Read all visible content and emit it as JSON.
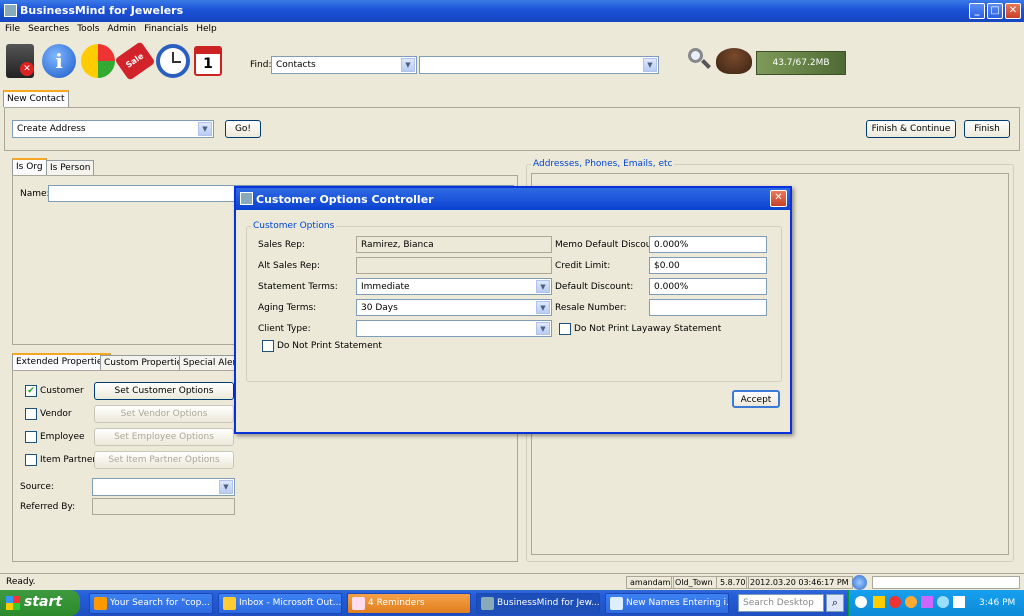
{
  "window": {
    "title": "BusinessMind for Jewelers"
  },
  "menu": [
    "File",
    "Searches",
    "Tools",
    "Admin",
    "Financials",
    "Help"
  ],
  "toolbar": {
    "icons": [
      "exit-icon",
      "info-icon",
      "chart-icon",
      "sale-tag-icon",
      "clock-icon",
      "calendar-icon"
    ],
    "calendar_day": "1",
    "find_label": "Find:",
    "find_type": "Contacts",
    "find_value": "",
    "memory": "43.7/67.2MB"
  },
  "doc_tab": "New Contact",
  "action_bar": {
    "action": "Create Address",
    "go": "Go!",
    "finish_continue": "Finish & Continue",
    "finish": "Finish"
  },
  "contact": {
    "tabs": [
      "Is Org",
      "Is Person"
    ],
    "name_label": "Name:",
    "name_value": ""
  },
  "addresses_group": "Addresses, Phones, Emails, etc",
  "properties": {
    "tabs": [
      "Extended Properties",
      "Custom Properties",
      "Special Alerts"
    ],
    "rows": [
      {
        "label": "Customer",
        "checked": true,
        "button": "Set Customer Options"
      },
      {
        "label": "Vendor",
        "checked": false,
        "button": "Set Vendor Options"
      },
      {
        "label": "Employee",
        "checked": false,
        "button": "Set Employee Options"
      },
      {
        "label": "Item Partner",
        "checked": false,
        "button": "Set Item Partner Options"
      }
    ],
    "source_label": "Source:",
    "source_value": "",
    "referred_label": "Referred By:",
    "referred_value": ""
  },
  "dialog": {
    "title": "Customer Options Controller",
    "group": "Customer Options",
    "sales_rep_label": "Sales Rep:",
    "sales_rep": "Ramirez, Bianca",
    "alt_sales_rep_label": "Alt Sales Rep:",
    "alt_sales_rep": "",
    "statement_terms_label": "Statement Terms:",
    "statement_terms": "Immediate",
    "aging_terms_label": "Aging Terms:",
    "aging_terms": "30 Days",
    "client_type_label": "Client Type:",
    "client_type": "",
    "do_not_print_statement": "Do Not Print Statement",
    "memo_discount_label": "Memo Default Discount:",
    "memo_discount": "0.000%",
    "credit_limit_label": "Credit Limit:",
    "credit_limit": "$0.00",
    "default_discount_label": "Default Discount:",
    "default_discount": "0.000%",
    "resale_number_label": "Resale Number:",
    "resale_number": "",
    "do_not_print_layaway": "Do Not Print Layaway Statement",
    "accept": "Accept"
  },
  "status": {
    "message": "Ready.",
    "user": "amandam",
    "location": "Old_Town",
    "version": "5.8.70",
    "datetime": "2012.03.20 03:46:17 PM",
    "field": ""
  },
  "taskbar": {
    "start": "start",
    "tasks": [
      "Your Search for \"cop...",
      "Inbox - Microsoft Out...",
      "4 Reminders",
      "BusinessMind for Jew...",
      "New Names Entering i..."
    ],
    "search_placeholder": "Search Desktop",
    "clock": "3:46 PM"
  },
  "colors": {
    "title_blue": "#1b52d6",
    "dialog_border": "#0831d9",
    "group_label": "#0046d5",
    "taskbar": "#245edb",
    "start_green": "#2c8a2c"
  }
}
